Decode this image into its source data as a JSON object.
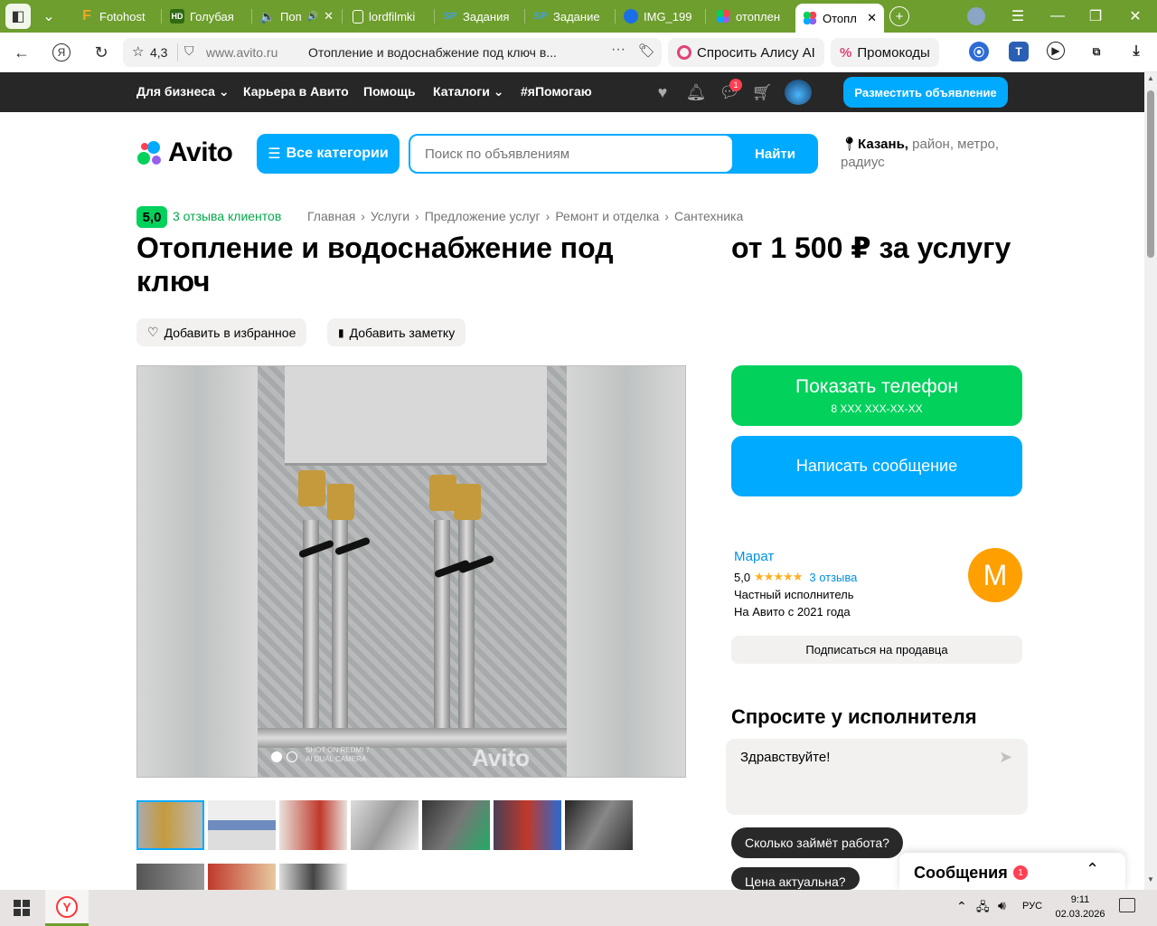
{
  "browser": {
    "tabs": [
      {
        "label": "Fotohost",
        "fav": "F",
        "favColor": "#f5a623",
        "favBg": "transparent"
      },
      {
        "label": "Голубая",
        "fav": "HD",
        "favColor": "#fff",
        "favBg": "#5b8c1d"
      },
      {
        "label": "Поп",
        "fav": "",
        "favColor": "#c00",
        "favBg": "transparent"
      },
      {
        "label": "lordfilmki",
        "fav": "",
        "favColor": "#fff",
        "favBg": "transparent"
      },
      {
        "label": "Задания",
        "fav": "SP",
        "favColor": "#3ea0e6",
        "favBg": "transparent"
      },
      {
        "label": "Задание",
        "fav": "SP",
        "favColor": "#3ea0e6",
        "favBg": "transparent"
      },
      {
        "label": "IMG_199",
        "fav": "",
        "favColor": "#1a6ee8",
        "favBg": "transparent"
      },
      {
        "label": "отоплен",
        "fav": "",
        "favColor": "#fff",
        "favBg": "transparent"
      },
      {
        "label": "Отопл",
        "fav": "",
        "favColor": "#fff",
        "favBg": "transparent"
      }
    ],
    "rating": "4,3",
    "url": "www.avito.ru",
    "page_title": "Отопление и водоснабжение под ключ в...",
    "alice": "Спросить Алису AI",
    "promo": "Промокоды"
  },
  "topnav": {
    "items": [
      "Для бизнеса",
      "Карьера в Авито",
      "Помощь",
      "Каталоги",
      "#яПомогаю"
    ],
    "notifications_count": "1",
    "place_ad": "Разместить объявление"
  },
  "header": {
    "logo": "Avito",
    "categories": "Все категории",
    "search_placeholder": "Поиск по объявлениям",
    "find": "Найти",
    "location_city": "Казань,",
    "location_rest": " район, метро, радиус"
  },
  "listing": {
    "rating": "5,0",
    "client_reviews": "3 отзыва клиентов",
    "breadcrumb": [
      "Главная",
      "Услуги",
      "Предложение услуг",
      "Ремонт и отделка",
      "Сантехника"
    ],
    "title": "Отопление и водоснабжение под ключ",
    "price": "от 1 500 ₽ за услугу",
    "add_favorite": "Добавить в избранное",
    "add_note": "Добавить заметку",
    "photo_watermark": "Avito",
    "photo_caption": "SHOT ON REDMI 7\nAI DUAL CAMERA"
  },
  "contact": {
    "show_phone": "Показать телефон",
    "phone_mask": "8 XXX XXX-XX-XX",
    "write_message": "Написать сообщение"
  },
  "seller": {
    "name": "Марат",
    "rating": "5,0",
    "stars": "★★★★★",
    "reviews": "3 отзыва",
    "type": "Частный исполнитель",
    "since": "На Авито с 2021 года",
    "avatar_letter": "М",
    "subscribe": "Подписаться на продавца"
  },
  "ask": {
    "title": "Спросите у исполнителя",
    "message": "Здравствуйте!",
    "quick_questions": [
      "Сколько займёт работа?",
      "Цена актуальна?"
    ]
  },
  "messages_panel": {
    "title": "Сообщения",
    "badge": "1"
  },
  "taskbar": {
    "lang": "РУС",
    "time": "9:11",
    "date": "02.03.2026"
  },
  "colors": {
    "accent_blue": "#00aaff",
    "accent_green": "#02d15c",
    "topnav_bg": "#272727",
    "browser_chrome": "#6e9e2e"
  }
}
